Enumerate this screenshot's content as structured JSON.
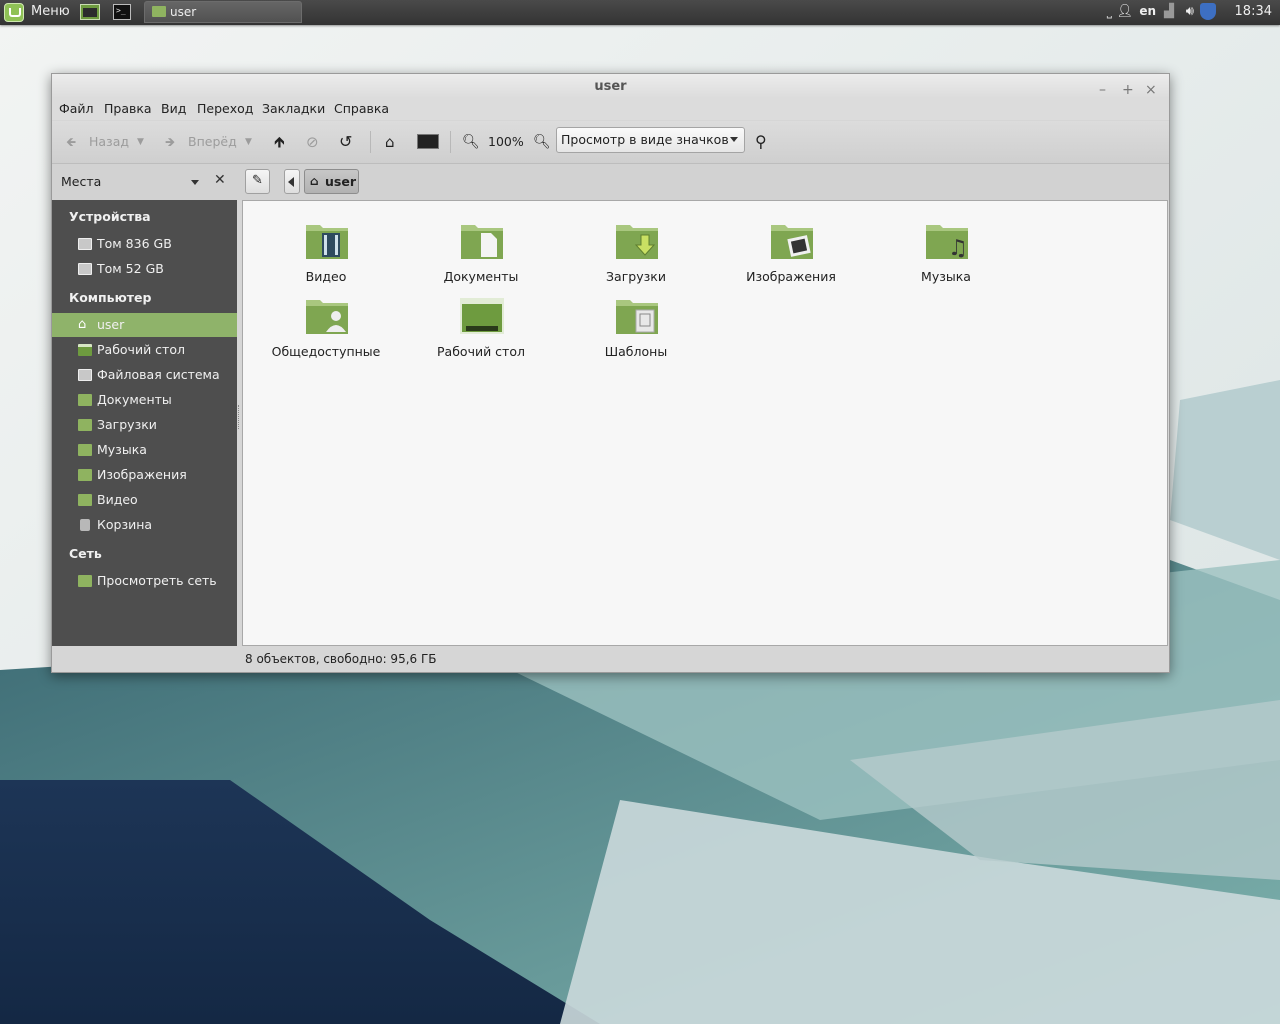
{
  "panel": {
    "menu_label": "Меню",
    "task_title": "user",
    "keyboard_layout": "en",
    "clock": "18:34"
  },
  "window": {
    "title": "user",
    "menu": [
      "Файл",
      "Правка",
      "Вид",
      "Переход",
      "Закладки",
      "Справка"
    ],
    "toolbar": {
      "back_label": "Назад",
      "forward_label": "Вперёд",
      "zoom_level": "100%",
      "view_mode": "Просмотр в виде значков"
    },
    "places_label": "Места",
    "breadcrumb": "user",
    "sidebar": {
      "devices_header": "Устройства",
      "devices": [
        "Том 836 GB",
        "Том 52 GB"
      ],
      "computer_header": "Компьютер",
      "computer": [
        {
          "label": "user",
          "icon": "home-icon",
          "active": true
        },
        {
          "label": "Рабочий стол",
          "icon": "desktop-icon"
        },
        {
          "label": "Файловая система",
          "icon": "drive-icon"
        },
        {
          "label": "Документы",
          "icon": "folder-icon"
        },
        {
          "label": "Загрузки",
          "icon": "folder-icon"
        },
        {
          "label": "Музыка",
          "icon": "folder-icon"
        },
        {
          "label": "Изображения",
          "icon": "folder-icon"
        },
        {
          "label": "Видео",
          "icon": "folder-icon"
        },
        {
          "label": "Корзина",
          "icon": "trash-icon"
        }
      ],
      "network_header": "Сеть",
      "network": [
        "Просмотреть сеть"
      ]
    },
    "files": [
      {
        "label": "Видео",
        "emblem": "film-icon"
      },
      {
        "label": "Документы",
        "emblem": "document-icon"
      },
      {
        "label": "Загрузки",
        "emblem": "download-arrow-icon"
      },
      {
        "label": "Изображения",
        "emblem": "picture-icon"
      },
      {
        "label": "Музыка",
        "emblem": "music-note-icon"
      },
      {
        "label": "Общедоступные",
        "emblem": "person-icon"
      },
      {
        "label": "Рабочий стол",
        "emblem": "desktop-icon"
      },
      {
        "label": "Шаблоны",
        "emblem": "template-icon"
      }
    ],
    "status": "8 объектов, свободно: 95,6 ГБ"
  },
  "colors": {
    "accent_green": "#8fb36a",
    "folder_green": "#8fb360",
    "sidebar_bg": "#4e4e4e"
  }
}
